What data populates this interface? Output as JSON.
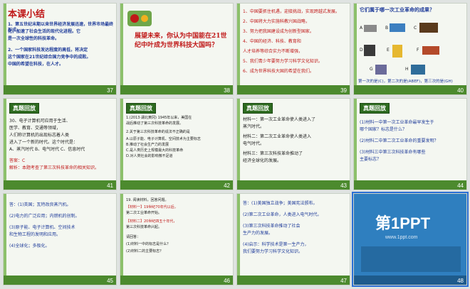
{
  "slides": [
    {
      "num": "37",
      "title": "本课小结",
      "lines": [
        "1、第五世纪末期以来世界经济发展迅速，世界市场最终形成。",
        "化，加速了社会生活的现代化进程。它",
        "是一次全球性的科技革命。",
        "2、一个国家科技发达程度的高低，将决定",
        "这个国家在21世纪综合国力竞争中的成败。",
        "中国的希望在科技，在人才。"
      ]
    },
    {
      "num": "38",
      "headline": "展望未来，你认为中国能在21世纪中叶成为世界科技大国吗？"
    },
    {
      "num": "39",
      "lines": [
        "1、中国要抓住机遇，迎接挑战，实现跨越式发展。",
        "2、中国将大力实施科教兴国战略，",
        "   3、努力把我国建设成为创新型国家。",
        "4、中国的经济、科技、教育和",
        "   人才培养等综合实力不断增强，",
        "5、我们青少年要努力学习科学文化知识。",
        "6、成为世界科技大国的希望在我们。"
      ]
    },
    {
      "num": "40",
      "question": "它们属于哪一次工业革命的成果？",
      "answer": "第一次的是(C)，第二次的是(ABEF)，第三次的是(GH)",
      "labels": [
        "A",
        "B",
        "C",
        "D",
        "E",
        "F",
        "G",
        "H"
      ]
    },
    {
      "num": "41",
      "tag": "真题回放",
      "lines": [
        "30、电子计算机可应用于生活、",
        "医学、教育、交通等领域，",
        "人们称计算机的出现标志着人类",
        "进入了一个新的时代。这个时代是：",
        "A、蒸汽时代  B、电气时代  C、信息时代"
      ],
      "answer": "答案：C",
      "note": "解析：本题考查了第三次科技革命的相关知识。"
    },
    {
      "num": "42",
      "tag": "真题回放",
      "lines": [
        "1.(2013·湖北黄冈) 1945年以来，美国在",
        "战后推动了第三次科技革命的发展。",
        "2.关于第三次科技革命的说法不正确的是",
        "A.以原子能、电子计算机、空间技术为主要标志",
        "B.推动了社会生产力的发展",
        "C.是人类历史上规模最大的科技革命",
        "D.对人类社会的影响微不足道"
      ]
    },
    {
      "num": "43",
      "tag": "真题回放",
      "lines": [
        "材料一：第一次工业革命使人类进入了",
        "蒸汽时代。",
        "材料二：第二次工业革命使人类进入",
        "电气时代。",
        "材料三：第三次科技革命推动了",
        "经济全球化的发展。"
      ]
    },
    {
      "num": "44",
      "tag": "真题回放",
      "lines": [
        "(1)材料一中第一次工业革命最早发生于",
        "哪个国家？标志是什么？",
        "(2)材料二中第二次工业革命的重要发明？",
        "(3)材料三中第三次科技革命有哪些",
        "主要标志？"
      ]
    },
    {
      "num": "45",
      "lines": [
        "答：(1)英国；瓦特改良蒸汽机。",
        "(2)电力的广泛应用；内燃机的创制。",
        "(3)原子能、电子计算机、空间技术",
        "和生物工程的发明和应用。",
        "(4)全球化；多极化。"
      ]
    },
    {
      "num": "46",
      "lines": [
        "19. 阅读材料，回答问题。",
        "【材料一】19世纪70年代以后，",
        "第二次工业革命开始。",
        "【材料二】20世纪四五十年代，",
        "第三次科技革命兴起。",
        "请回答：",
        "(1)材料一中的标志是什么？",
        "(2)材料二的主要标志？"
      ]
    },
    {
      "num": "47",
      "lines": [
        "答：(1)美国独立战争；美国宪法颁布。",
        "(2)第二次工业革命，人类进入电气时代。",
        "(3)第三次科技革命推动了社会",
        "生产力的发展。",
        "(4)启示：科学技术是第一生产力，",
        "我们要努力学习科学文化知识。"
      ]
    },
    {
      "num": "48",
      "brand": "第1PPT",
      "site": "www.1ppt.com"
    }
  ]
}
